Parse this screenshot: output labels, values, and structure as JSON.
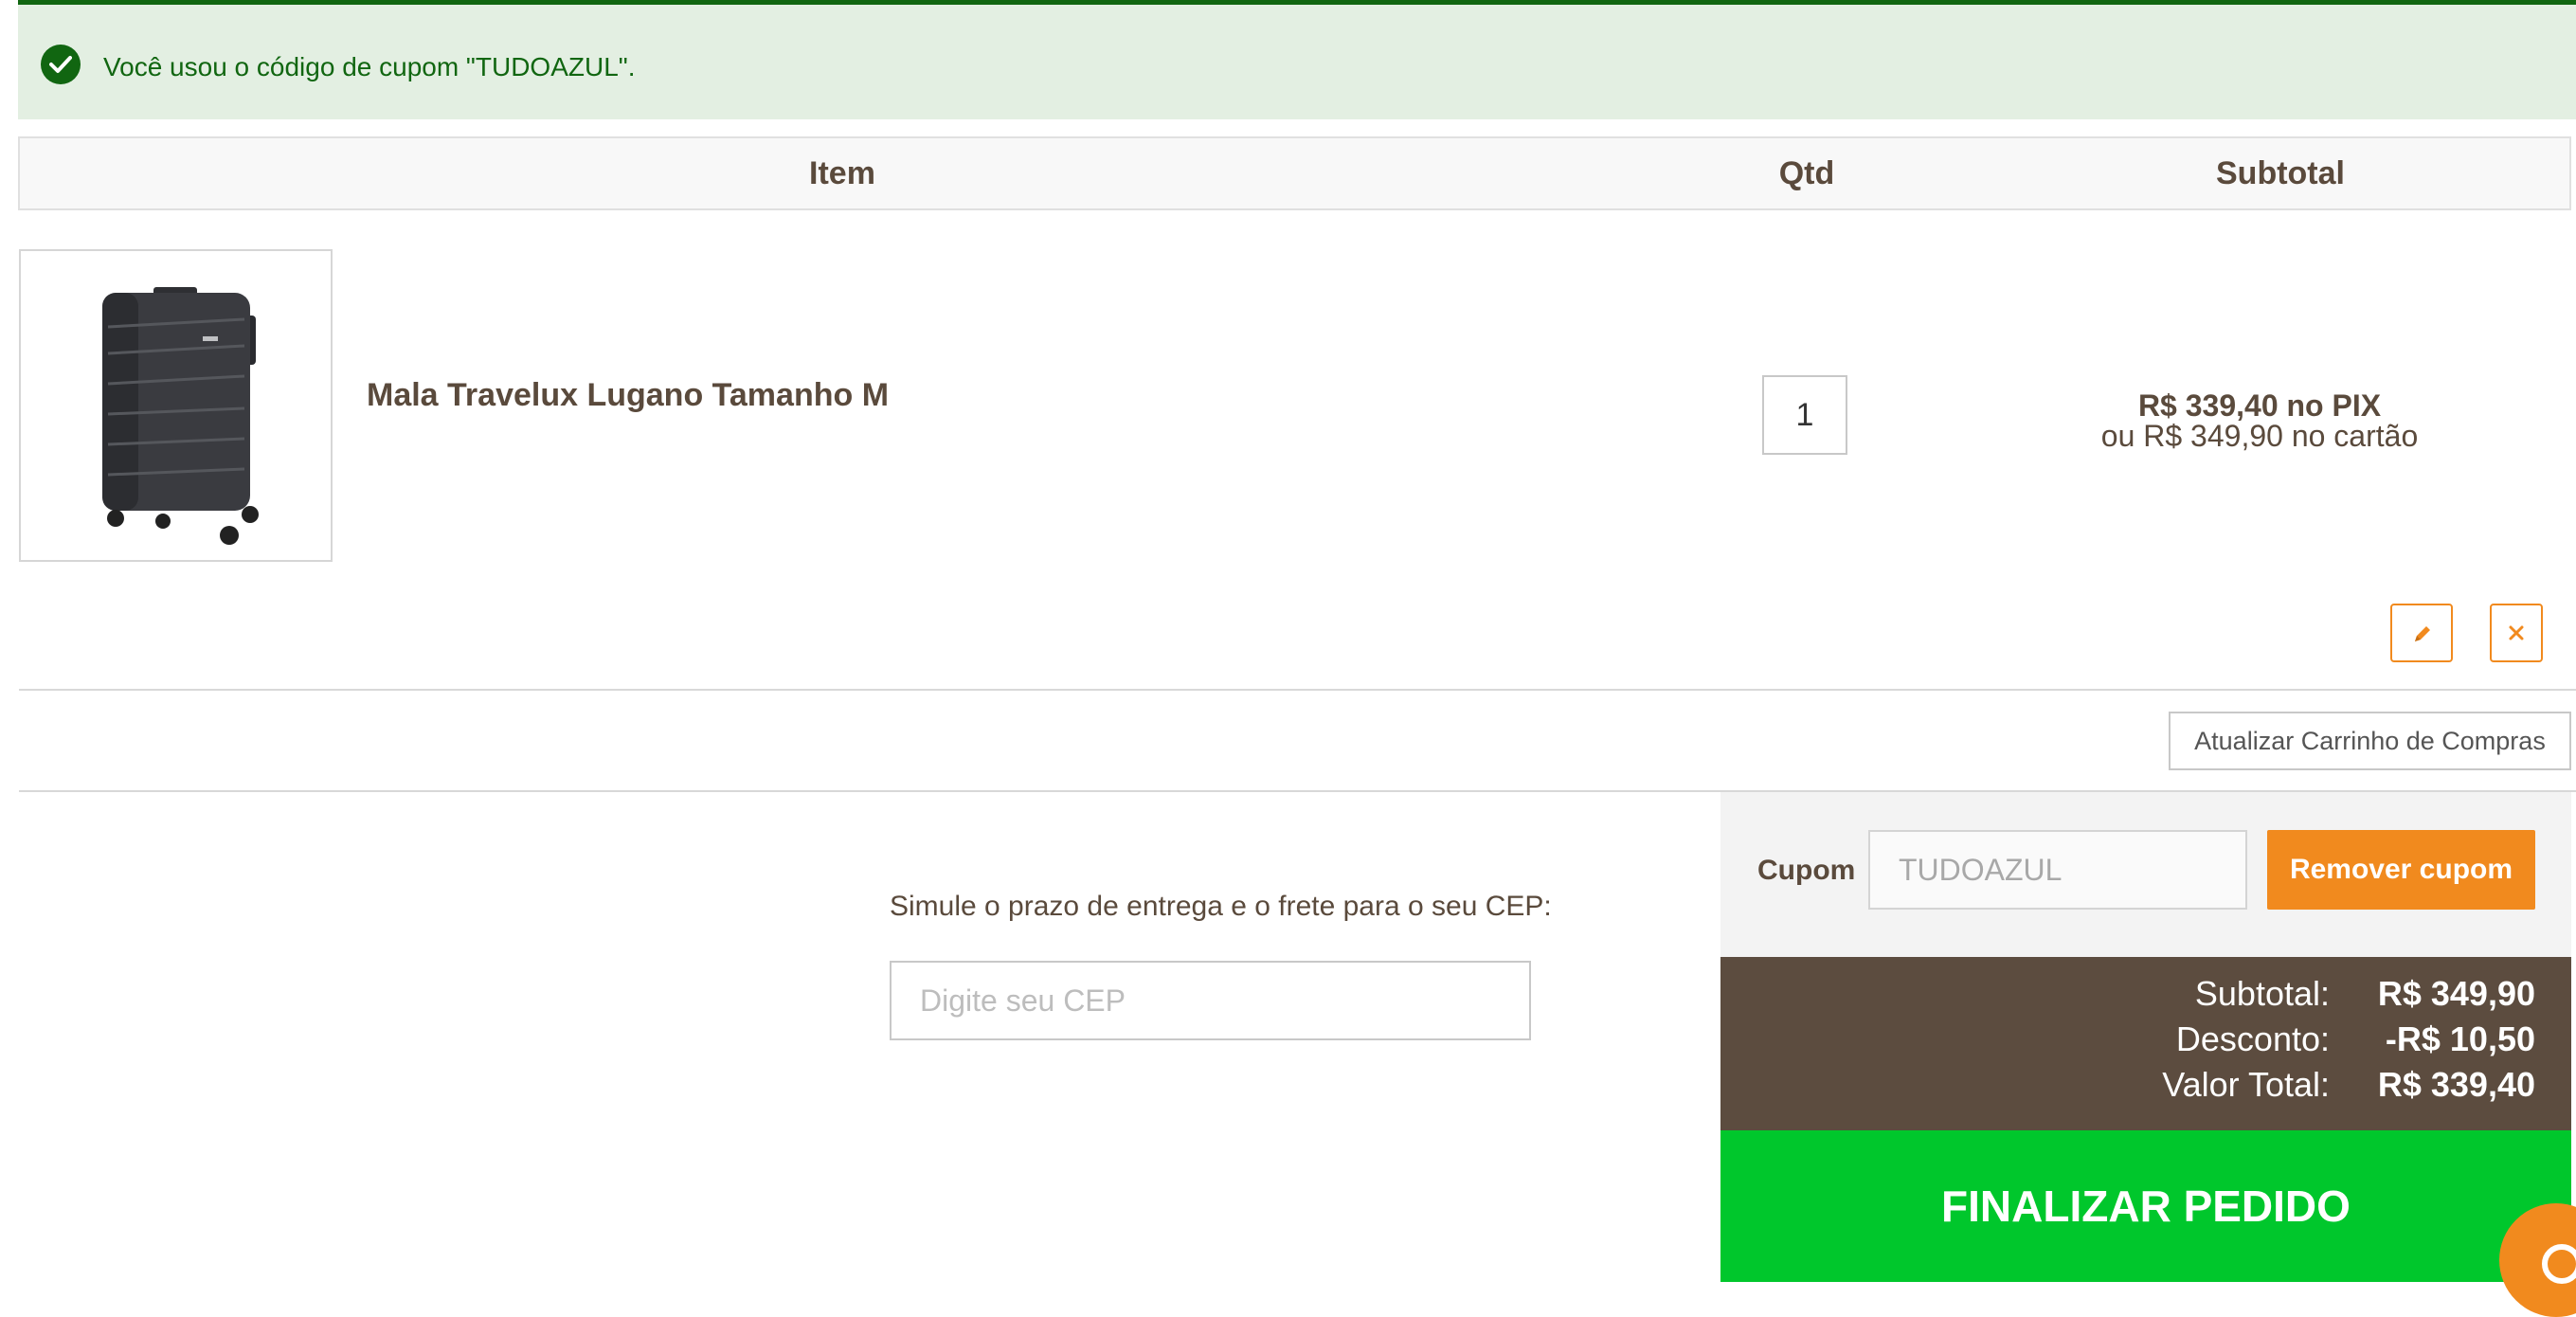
{
  "alert": {
    "message": "Você usou o código de cupom \"TUDOAZUL\".",
    "icon": "check-circle-icon",
    "color": "#116611"
  },
  "table": {
    "headers": {
      "item": "Item",
      "qty": "Qtd",
      "subtotal": "Subtotal"
    }
  },
  "cart_item": {
    "name": "Mala Travelux Lugano Tamanho M",
    "quantity": "1",
    "price_pix": "R$ 339,40 no PIX",
    "price_card": "ou R$ 349,90 no cartão",
    "edit_icon": "pencil-icon",
    "remove_icon": "close-icon"
  },
  "actions": {
    "update_cart": "Atualizar Carrinho de Compras"
  },
  "shipping": {
    "label": "Simule o prazo de entrega e o frete para o seu CEP:",
    "placeholder": "Digite seu CEP"
  },
  "coupon": {
    "label": "Cupom",
    "value": "TUDOAZUL",
    "remove_label": "Remover cupom"
  },
  "totals": {
    "subtotal_label": "Subtotal:",
    "subtotal_value": "R$ 349,90",
    "discount_label": "Desconto:",
    "discount_value": "-R$ 10,50",
    "total_label": "Valor Total:",
    "total_value": "R$ 339,40"
  },
  "checkout": {
    "label": "FINALIZAR PEDIDO"
  },
  "colors": {
    "accent_orange": "#f18a1e",
    "checkout_green": "#00c72c",
    "summary_brown": "#5c4c3f",
    "success_bg": "#e3efe2"
  }
}
